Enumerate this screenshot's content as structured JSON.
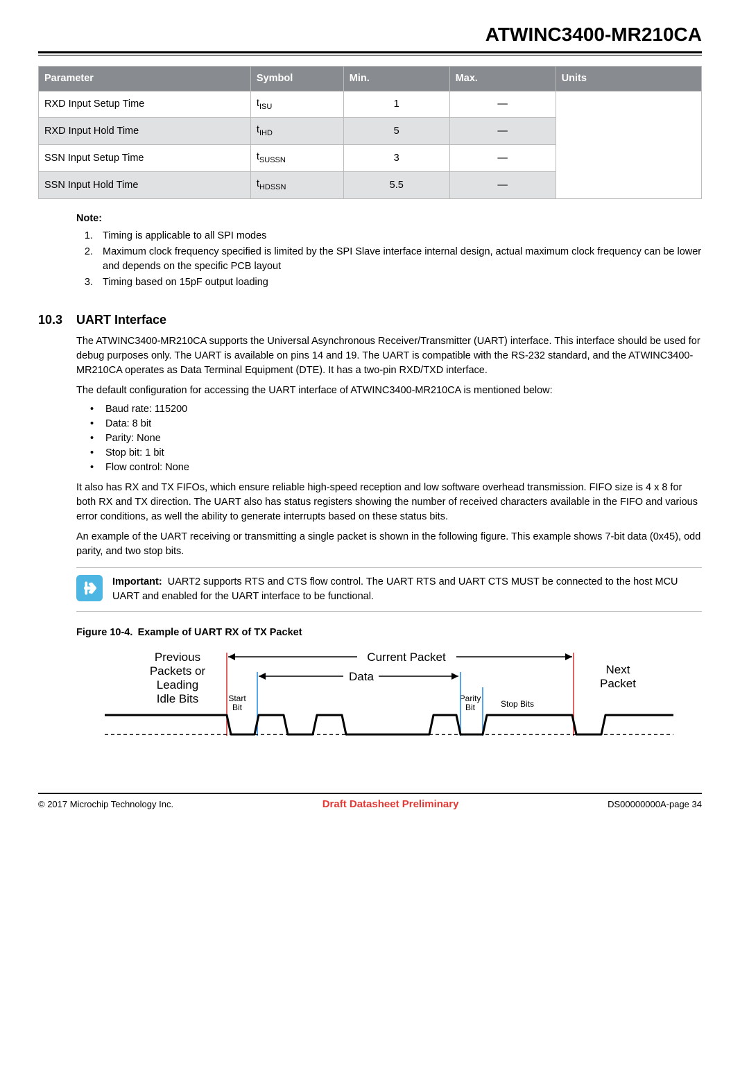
{
  "header": {
    "product_title": "ATWINC3400-MR210CA"
  },
  "table": {
    "headers": [
      "Parameter",
      "Symbol",
      "Min.",
      "Max.",
      "Units"
    ],
    "rows": [
      {
        "param": "RXD Input Setup Time",
        "sym_base": "t",
        "sym_sub": "ISU",
        "min": "1",
        "max": "—",
        "units": ""
      },
      {
        "param": "RXD Input Hold Time",
        "sym_base": "t",
        "sym_sub": "IHD",
        "min": "5",
        "max": "—",
        "units": ""
      },
      {
        "param": "SSN Input Setup Time",
        "sym_base": "t",
        "sym_sub": "SUSSN",
        "min": "3",
        "max": "—",
        "units": ""
      },
      {
        "param": "SSN Input Hold Time",
        "sym_base": "t",
        "sym_sub": "HDSSN",
        "min": "5.5",
        "max": "—",
        "units": ""
      }
    ]
  },
  "note": {
    "heading": "Note:",
    "items": [
      "Timing is applicable to all SPI modes",
      "Maximum clock frequency specified is limited by the SPI Slave interface internal design, actual maximum clock frequency can be lower and depends on the specific PCB layout",
      "Timing based on 15pF output loading"
    ]
  },
  "section": {
    "number": "10.3",
    "title": "UART Interface",
    "para1": "The ATWINC3400-MR210CA supports the Universal Asynchronous Receiver/Transmitter (UART) interface. This interface should be used for debug purposes only. The UART is available on pins 14 and 19. The UART is compatible with the RS-232 standard, and the ATWINC3400-MR210CA operates as Data Terminal Equipment (DTE). It has a two-pin RXD/TXD interface.",
    "para2": "The default configuration for accessing the UART interface of ATWINC3400-MR210CA is mentioned below:",
    "config": [
      "Baud rate: 115200",
      "Data: 8 bit",
      "Parity: None",
      "Stop bit: 1 bit",
      "Flow control: None"
    ],
    "para3": "It also has RX and TX FIFOs, which ensure reliable high-speed reception and low software overhead transmission. FIFO size is 4 x 8 for both RX and TX direction. The UART also has status registers showing the number of received characters available in the FIFO and various error conditions, as well the ability to generate interrupts based on these status bits.",
    "para4": "An example of the UART receiving or transmitting a single packet is shown in the following figure. This example shows 7-bit data (0x45), odd parity, and two stop bits."
  },
  "important": {
    "label": "Important:",
    "text": "UART2 supports RTS and CTS flow control. The UART RTS and UART CTS MUST be connected to the host MCU UART and enabled for the UART interface to be functional."
  },
  "figure": {
    "caption": "Figure 10-4. Example of UART RX of TX Packet",
    "labels": {
      "previous": "Previous Packets or Leading Idle Bits",
      "current": "Current Packet",
      "data": "Data",
      "next": "Next Packet",
      "start": "Start Bit",
      "parity": "Parity Bit",
      "stop": "Stop Bits"
    }
  },
  "footer": {
    "left": "© 2017 Microchip Technology Inc.",
    "center": "Draft Datasheet Preliminary",
    "right": "DS00000000A-page 34"
  }
}
